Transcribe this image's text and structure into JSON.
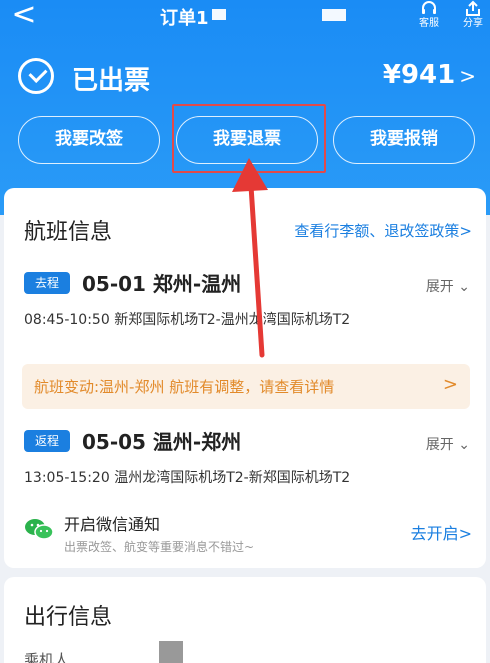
{
  "nav": {
    "back_glyph": "<",
    "title": "订单1",
    "service_label": "客服",
    "share_label": "分享",
    "service_icon": "headset-icon",
    "share_icon": "share-icon"
  },
  "status": {
    "text": "已出票",
    "price": "¥941",
    "price_chevron": ">"
  },
  "actions": [
    {
      "label": "我要改签"
    },
    {
      "label": "我要退票"
    },
    {
      "label": "我要报销"
    }
  ],
  "flight_section": {
    "title": "航班信息",
    "policy_link": "查看行李额、退改签政策",
    "link_chevron": ">",
    "legs": [
      {
        "badge": "去程",
        "title": "05-01 郑州-温州",
        "expand": "展开",
        "detail": "08:45-10:50 新郑国际机场T2-温州龙湾国际机场T2"
      },
      {
        "badge": "返程",
        "title": "05-05 温州-郑州",
        "expand": "展开",
        "detail": "13:05-15:20 温州龙湾国际机场T2-新郑国际机场T2"
      }
    ],
    "change_notice": "航班变动:温州-郑州 航班有调整，请查看详情",
    "change_chevron": ">",
    "wechat": {
      "title": "开启微信通知",
      "subtitle": "出票改签、航变等重要消息不错过~",
      "link": "去开启>"
    }
  },
  "travel_section": {
    "title": "出行信息",
    "passenger_label": "乘机人"
  },
  "colors": {
    "brand_blue": "#1a8cf5",
    "link_blue": "#1b7fe0",
    "notice_orange": "#e28a2a",
    "annotation_red": "#e24a4a"
  }
}
